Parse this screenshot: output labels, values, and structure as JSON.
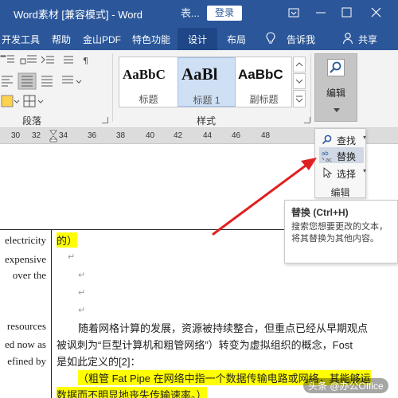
{
  "titlebar": {
    "title": "Word素材 [兼容模式] - Word",
    "tool_tab": "表...",
    "login_label": "登录"
  },
  "menubar": {
    "tabs": [
      "开发工具",
      "帮助",
      "金山PDF",
      "特色功能",
      "设计",
      "布局"
    ],
    "tell_me": "告诉我",
    "share": "共享"
  },
  "ribbon": {
    "paragraph_label": "段落",
    "styles_label": "样式",
    "styles": [
      {
        "sample": "AaBbC",
        "name": "标题"
      },
      {
        "sample": "AaBl",
        "name": "标题 1"
      },
      {
        "sample": "AaBbC",
        "name": "副标题"
      }
    ],
    "edit_label": "编辑"
  },
  "ruler": {
    "ticks": [
      "30",
      "32",
      "34",
      "36",
      "38",
      "40",
      "42",
      "44",
      "46",
      "48"
    ]
  },
  "edit_panel": {
    "find": "查找",
    "replace": "替换",
    "select": "选择",
    "label": "编辑"
  },
  "tooltip": {
    "title": "替换 (Ctrl+H)",
    "description": "搜索您想要更改的文本，将其替换为其他内容。"
  },
  "document": {
    "left_lines": [
      "electricity",
      "expensive",
      "over the",
      "resources",
      "ed now as",
      "efined by"
    ],
    "right_top": "的）",
    "paragraph_lines": [
      "随着网格计算的发展，资源被持续整合，但重点已经从早期观点",
      "被讽刺为“巨型计算机和粗管网络”）转变为虚拟组织的概念，Fost",
      "是如此定义的[2]："
    ],
    "highlight_lines": [
      "（粗管 Fat Pipe 在网络中指一个数据传输电路或网络，其能够运",
      "数据而不明显地丧失传输速率。）"
    ]
  },
  "watermark": "头条 @办公Office",
  "colors": {
    "title_blue": "#2b579a",
    "highlight": "#ffff00",
    "arrow": "#e02020"
  }
}
